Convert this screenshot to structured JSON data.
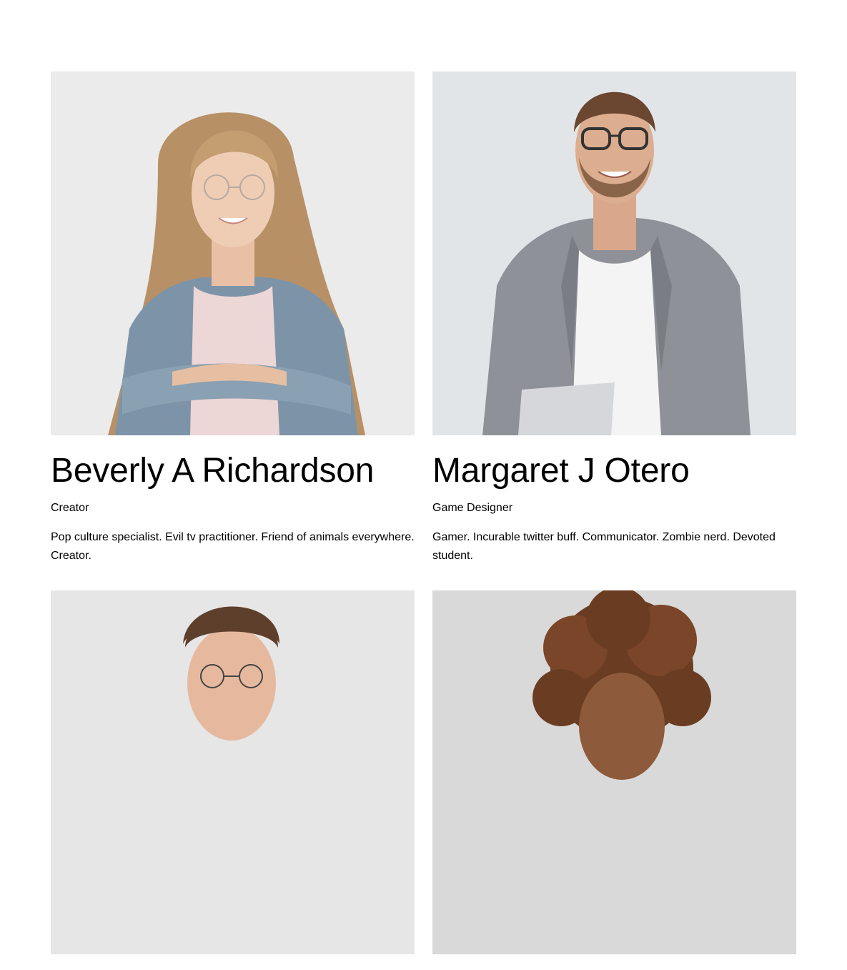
{
  "team": {
    "members": [
      {
        "name": "Beverly A Richardson",
        "role": "Creator",
        "bio": "Pop culture specialist. Evil tv practitioner. Friend of animals everywhere. Creator."
      },
      {
        "name": "Margaret J Otero",
        "role": "Game Designer",
        "bio": "Gamer. Incurable twitter buff. Communicator. Zombie nerd. Devoted student."
      },
      {
        "name": "",
        "role": "",
        "bio": ""
      },
      {
        "name": "",
        "role": "",
        "bio": ""
      }
    ]
  },
  "colors": {
    "background": "#ffffff",
    "text": "#000000",
    "photo_bg": "#e8e8e8"
  }
}
